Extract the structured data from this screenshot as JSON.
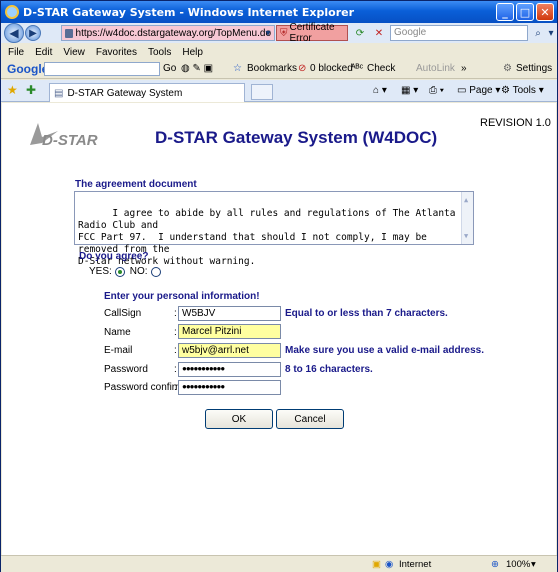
{
  "window": {
    "title": "D-STAR Gateway System - Windows Internet Explorer"
  },
  "address": {
    "url": "https://w4doc.dstargateway.org/TopMenu.do",
    "certificate": "Certificate Error",
    "search_placeholder": "Google"
  },
  "menu": [
    "File",
    "Edit",
    "View",
    "Favorites",
    "Tools",
    "Help"
  ],
  "google_toolbar": {
    "logo": "Google",
    "go": "Go",
    "bookmarks": "Bookmarks",
    "blocked": "0 blocked",
    "check": "Check",
    "autolink": "AutoLink",
    "settings": "Settings"
  },
  "tabbar": {
    "tab_title": "D-STAR Gateway System",
    "page": "Page",
    "tools": "Tools"
  },
  "page": {
    "logo_text": "D-STAR",
    "revision": "REVISION 1.0",
    "title": "D-STAR Gateway System (W4DOC)",
    "agreement_heading": "The agreement document",
    "agreement_text": "I agree to abide by all rules and regulations of The Atlanta Radio Club and\nFCC Part 97.  I understand that should I not comply, I may be removed from the\nD-Star network without warning.",
    "agree_question": "Do you agree?",
    "yes_label": "YES:",
    "no_label": "NO:",
    "personal_heading": "Enter your personal information!",
    "fields": [
      {
        "label": "CallSign",
        "value": "W5BJV",
        "hint": "Equal to or less than 7 characters."
      },
      {
        "label": "Name",
        "value": "Marcel Pitzini",
        "hint": ""
      },
      {
        "label": "E-mail",
        "value": "w5bjv@arrl.net",
        "hint": "Make sure you use a valid e-mail address."
      },
      {
        "label": "Password",
        "value": "●●●●●●●●●●●",
        "hint": "8 to 16 characters."
      },
      {
        "label": "Password confirm",
        "value": "●●●●●●●●●●●",
        "hint": ""
      }
    ],
    "ok_label": "OK",
    "cancel_label": "Cancel"
  },
  "status": {
    "zone": "Internet",
    "zoom": "100%"
  }
}
